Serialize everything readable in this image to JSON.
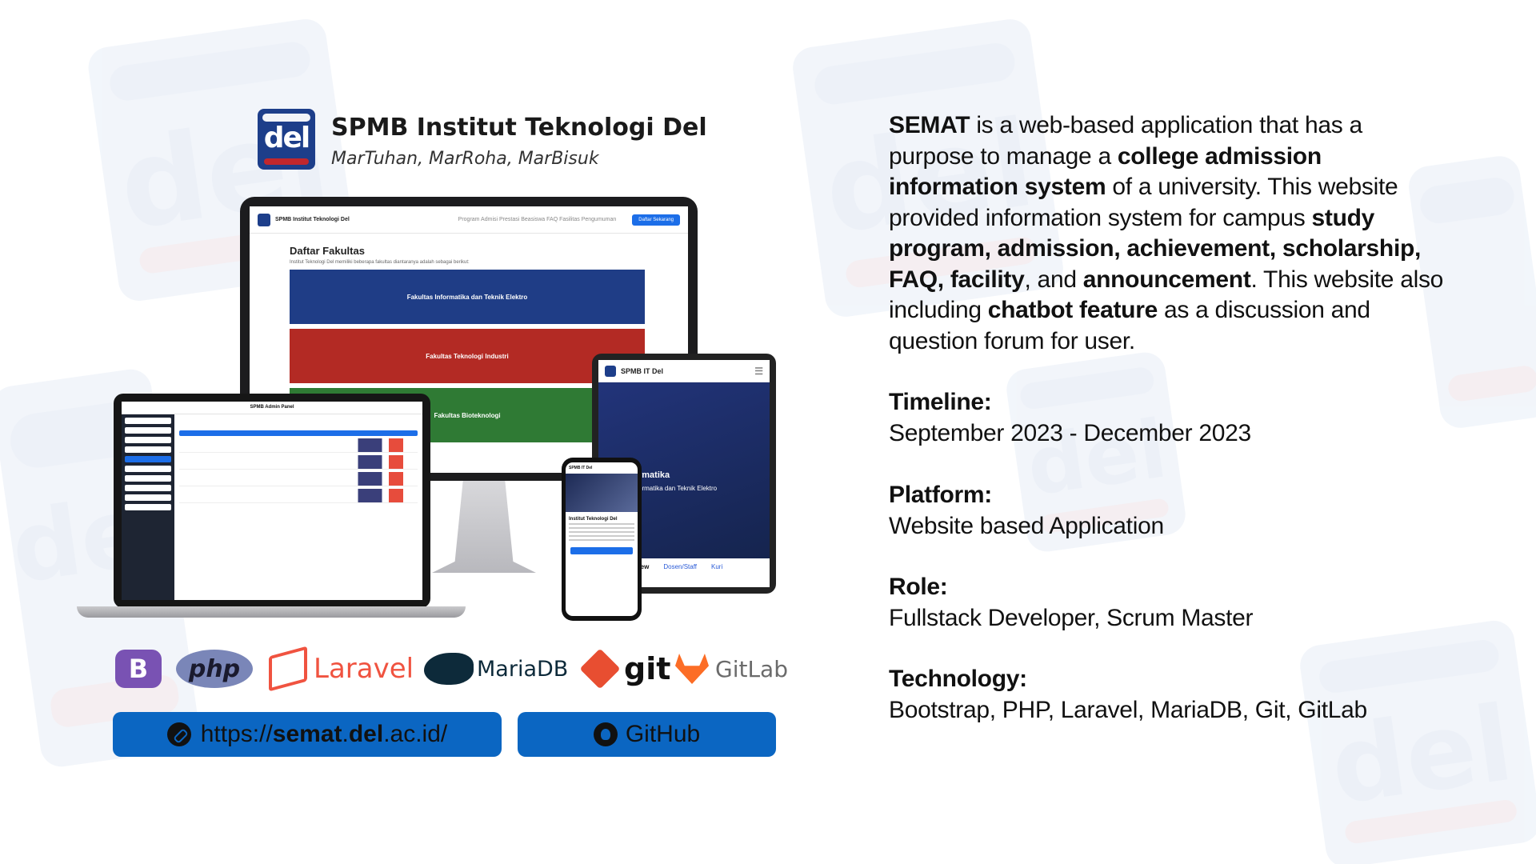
{
  "brand": {
    "title": "SPMB Institut Teknologi Del",
    "motto": "MarTuhan, MarRoha, MarBisuk",
    "logo_text": "del"
  },
  "monitor": {
    "nav_brand": "SPMB Institut Teknologi Del",
    "nav_links": "Program   Admisi   Prestasi   Beasiswa   FAQ   Fasilitas   Pengumuman",
    "nav_button": "Daftar Sekarang",
    "heading": "Daftar Fakultas",
    "sub": "Institut Teknologi Del memiliki beberapa fakultas diantaranya adalah sebagai berikut:",
    "cards": [
      {
        "label": "Fakultas Informatika dan Teknik Elektro",
        "color": "#1f3d86"
      },
      {
        "label": "Fakultas Teknologi Industri",
        "color": "#b32a24"
      },
      {
        "label": "Fakultas Bioteknologi",
        "color": "#2f7a34"
      }
    ]
  },
  "tablet": {
    "nav_brand": "SPMB IT Del",
    "hero_title": "rmatika",
    "hero_sub": "ormatika dan Teknik Elektro",
    "tabs": [
      "view",
      "Dosen/Staff",
      "Kuri"
    ]
  },
  "laptop": {
    "title": "SPMB Admin Panel"
  },
  "phone": {
    "nav_brand": "SPMB IT Del",
    "title": "Institut Teknologi Del"
  },
  "tech_logos": {
    "bootstrap": "B",
    "php": "php",
    "laravel": "Laravel",
    "mariadb": "MariaDB",
    "git": "git",
    "gitlab": "GitLab"
  },
  "links": {
    "website_prefix": "https://",
    "website_bold1": "semat",
    "website_dot": ".",
    "website_bold2": "del",
    "website_suffix": ".ac.id/",
    "github_label": "GitHub"
  },
  "description": {
    "p1": "SEMAT",
    "p2": " is a web-based application that has a purpose to manage a ",
    "p3": "college admission information system",
    "p4": " of a university. This website provided information system for campus ",
    "p5": "study program, admission, achievement, scholarship, FAQ, facility",
    "p6": ", and ",
    "p7": "announcement",
    "p8": ". This website also including ",
    "p9": "chatbot feature",
    "p10": " as a discussion and question forum for user."
  },
  "info": {
    "timeline_label": "Timeline:",
    "timeline_value": "September 2023 - December 2023",
    "platform_label": "Platform:",
    "platform_value": "Website based Application",
    "role_label": "Role:",
    "role_value": "Fullstack Developer, Scrum Master",
    "technology_label": "Technology:",
    "technology_value": "Bootstrap, PHP, Laravel, MariaDB, Git, GitLab"
  }
}
